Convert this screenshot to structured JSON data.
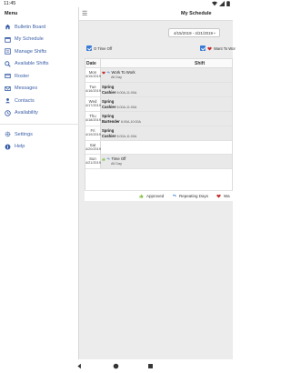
{
  "status_bar": {
    "time": "11:45"
  },
  "drawer": {
    "title": "Menu",
    "items": [
      {
        "label": "Bulletin Board",
        "icon": "home-icon"
      },
      {
        "label": "My Schedule",
        "icon": "calendar-icon"
      },
      {
        "label": "Manage Shifts",
        "icon": "list-icon"
      },
      {
        "label": "Available Shifts",
        "icon": "search-icon"
      },
      {
        "label": "Roster",
        "icon": "roster-icon"
      },
      {
        "label": "Messages",
        "icon": "mail-icon"
      },
      {
        "label": "Contacts",
        "icon": "contacts-icon"
      },
      {
        "label": "Availability",
        "icon": "clock-icon"
      }
    ],
    "secondary_items": [
      {
        "label": "Settings",
        "icon": "gear-icon"
      },
      {
        "label": "Help",
        "icon": "info-icon"
      }
    ]
  },
  "header": {
    "title": "My Schedule"
  },
  "date_range": {
    "value": "4/15/2019 - 4/21/2019"
  },
  "filters": {
    "time_off_label": "O  Time Off",
    "want_to_work_label": "Want To Wor"
  },
  "table": {
    "headers": {
      "date": "Date",
      "shift": "Shift"
    },
    "rows": [
      {
        "day": "Mon",
        "date": "4/15/2019",
        "line1": "Work To Work",
        "line2": "All Day"
      },
      {
        "day": "Tue",
        "date": "4/16/2019",
        "line1": "Spring",
        "role": "Cashier",
        "time": "6:00A-11:00A"
      },
      {
        "day": "Wed",
        "date": "4/17/2019",
        "line1": "Spring",
        "role": "Cashier",
        "time": "6:00A-11:00A"
      },
      {
        "day": "Thu",
        "date": "4/18/2019",
        "line1": "Spring",
        "role": "Bartender",
        "time": "6:00A-10:00A"
      },
      {
        "day": "Fri",
        "date": "4/19/2019",
        "line1": "Spring",
        "role": "Cashier",
        "time": "6:00A-11:00A"
      },
      {
        "day": "Sat",
        "date": "4/20/2019"
      },
      {
        "day": "Sun",
        "date": "4/21/2019",
        "line1": "Time Off",
        "line2": "All Day"
      }
    ]
  },
  "legend": {
    "approved": "Approved",
    "repeating_days": "Repeating Days",
    "want": "Wa"
  },
  "colors": {
    "accent": "#3a7bd5",
    "link": "#3b5fa8",
    "approved": "#8bc34a",
    "heart": "#c62828"
  }
}
